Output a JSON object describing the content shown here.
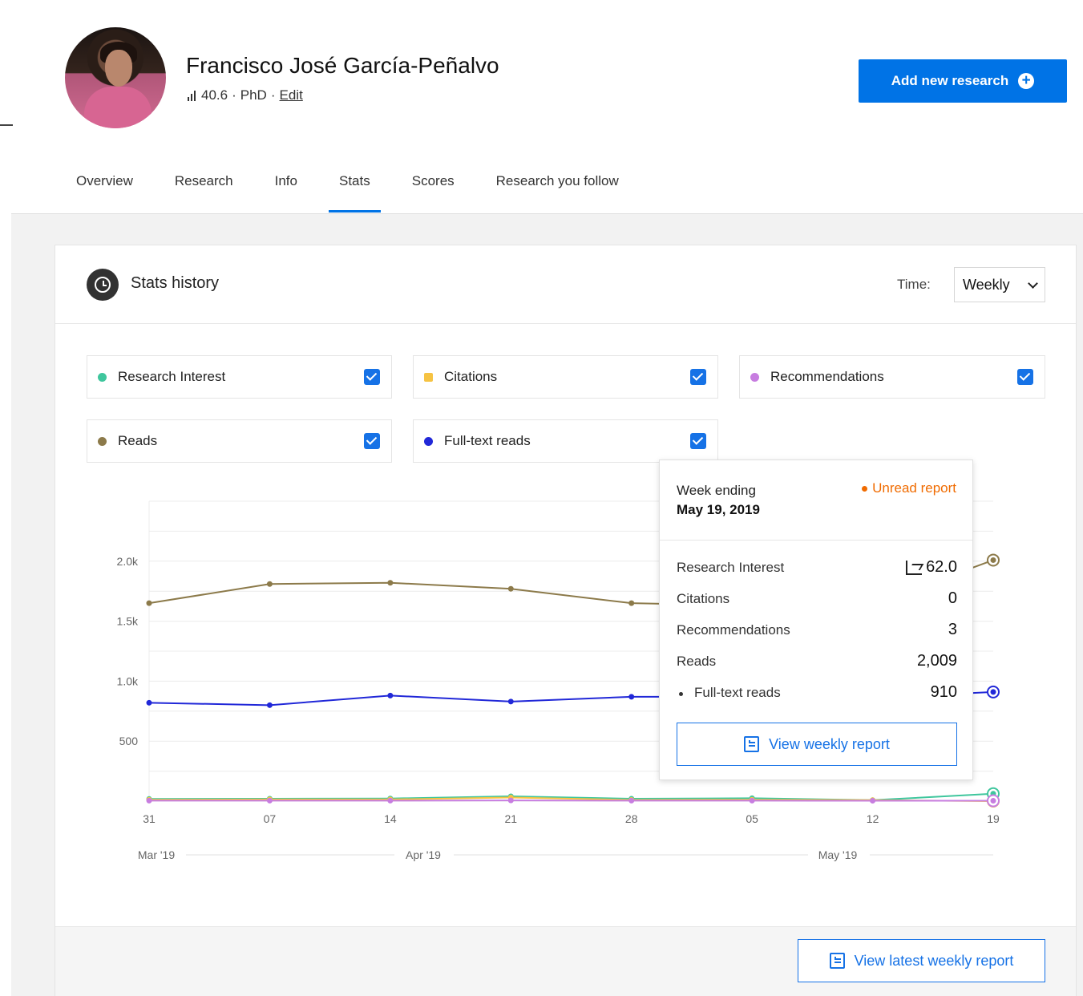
{
  "profile": {
    "name": "Francisco José García-Peñalvo",
    "score": "40.6",
    "degree": "PhD",
    "separator": "·",
    "edit_label": "Edit"
  },
  "actions": {
    "add_research_label": "Add new research",
    "add_research_icon": "plus-circle-icon"
  },
  "tabs": [
    {
      "label": "Overview",
      "active": false
    },
    {
      "label": "Research",
      "active": false
    },
    {
      "label": "Info",
      "active": false
    },
    {
      "label": "Stats",
      "active": true
    },
    {
      "label": "Scores",
      "active": false
    },
    {
      "label": "Research you follow",
      "active": false
    }
  ],
  "stats_history": {
    "title": "Stats history",
    "time_label": "Time:",
    "time_value": "Weekly",
    "metrics": [
      {
        "label": "Research Interest",
        "color": "#3fc69d",
        "checked": true
      },
      {
        "label": "Citations",
        "color": "#f6c343",
        "checked": true
      },
      {
        "label": "Recommendations",
        "color": "#c77de0",
        "checked": true
      },
      {
        "label": "Reads",
        "color": "#8c7a4a",
        "checked": true
      },
      {
        "label": "Full-text reads",
        "color": "#2128d8",
        "checked": true
      }
    ]
  },
  "tooltip": {
    "week_label": "Week ending",
    "week_date": "May 19, 2019",
    "unread_label": "Unread report",
    "rows": [
      {
        "label": "Research Interest",
        "value": "62.0"
      },
      {
        "label": "Citations",
        "value": "0"
      },
      {
        "label": "Recommendations",
        "value": "3"
      },
      {
        "label": "Reads",
        "value": "2,009"
      },
      {
        "label": "Full-text reads",
        "value": "910"
      }
    ],
    "button_label": "View weekly report"
  },
  "footer": {
    "button_label": "View latest weekly report"
  },
  "colors": {
    "primary": "#0073e6",
    "orange": "#f06b00",
    "reads": "#8c7a4a",
    "fulltext": "#2128d8",
    "research_interest": "#3fc69d",
    "citations": "#f6c343",
    "recommendations": "#c77de0"
  },
  "chart_data": {
    "type": "line",
    "categories": [
      "31",
      "07",
      "14",
      "21",
      "28",
      "05",
      "12",
      "19"
    ],
    "month_labels": [
      "Mar '19",
      "Apr '19",
      "May '19"
    ],
    "y_ticks": [
      "500",
      "1.0k",
      "1.5k",
      "2.0k"
    ],
    "ylim": [
      0,
      2500
    ],
    "series": [
      {
        "name": "Reads",
        "color": "#8c7a4a",
        "values": [
          1650,
          1810,
          1820,
          1770,
          1650,
          1630,
          1640,
          2009
        ]
      },
      {
        "name": "Full-text reads",
        "color": "#2128d8",
        "values": [
          820,
          800,
          880,
          830,
          870,
          870,
          860,
          910
        ]
      },
      {
        "name": "Research Interest",
        "color": "#3fc69d",
        "values": [
          18,
          20,
          22,
          40,
          20,
          24,
          8,
          62
        ]
      },
      {
        "name": "Citations",
        "color": "#f6c343",
        "values": [
          12,
          14,
          14,
          30,
          10,
          12,
          8,
          0
        ]
      },
      {
        "name": "Recommendations",
        "color": "#c77de0",
        "values": [
          4,
          4,
          4,
          6,
          4,
          4,
          3,
          3
        ]
      }
    ]
  }
}
